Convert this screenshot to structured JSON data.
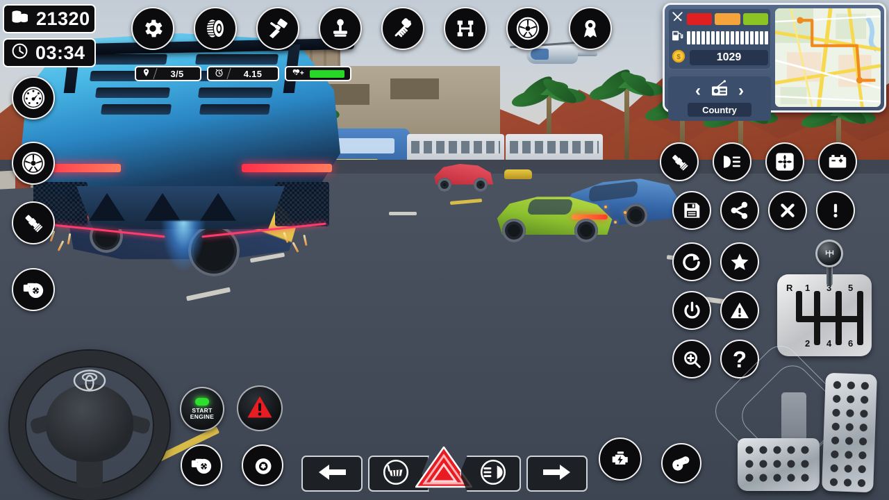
{
  "hud": {
    "coins_label": "coins",
    "coins_value": "21320",
    "timer_value": "03:34",
    "checkpoint_value": "3/5",
    "lap_time_value": "4.15",
    "health_label": "health"
  },
  "top_toolbar": [
    {
      "name": "settings",
      "icon": "gear-icon"
    },
    {
      "name": "tires",
      "icon": "tire-icon"
    },
    {
      "name": "engine",
      "icon": "piston-icon"
    },
    {
      "name": "gearbox",
      "icon": "joystick-icon"
    },
    {
      "name": "suspension",
      "icon": "shock-absorber-icon"
    },
    {
      "name": "chassis",
      "icon": "chassis-icon"
    },
    {
      "name": "rims",
      "icon": "wheel-rim-icon"
    },
    {
      "name": "rewards",
      "icon": "award-ribbon-icon"
    }
  ],
  "left_toolbar": [
    {
      "name": "speedometer",
      "icon": "speedometer-icon"
    },
    {
      "name": "wheel",
      "icon": "wheel-rim-icon"
    },
    {
      "name": "spark-plug",
      "icon": "spark-plug-icon"
    },
    {
      "name": "turbo",
      "icon": "turbo-icon"
    }
  ],
  "right_toolbar": [
    {
      "name": "spark-plug",
      "icon": "spark-plug-icon"
    },
    {
      "name": "headlights",
      "icon": "headlight-icon"
    },
    {
      "name": "cooling-fan",
      "icon": "fan-icon"
    },
    {
      "name": "battery",
      "icon": "battery-icon"
    },
    {
      "name": "save",
      "icon": "floppy-disk-icon"
    },
    {
      "name": "share",
      "icon": "share-icon"
    },
    {
      "name": "close",
      "icon": "close-x-icon"
    },
    {
      "name": "alert",
      "icon": "exclamation-icon"
    },
    {
      "name": "restart",
      "icon": "restart-icon"
    },
    {
      "name": "favorite",
      "icon": "star-icon"
    },
    {
      "name": "power",
      "icon": "power-icon"
    },
    {
      "name": "warning",
      "icon": "warning-triangle-icon"
    },
    {
      "name": "zoom-in",
      "icon": "magnifier-plus-icon"
    },
    {
      "name": "help",
      "icon": "question-mark-icon"
    }
  ],
  "dashboard": {
    "condition_label": "tools",
    "condition_segments": [
      "#e02020",
      "#f5a43c",
      "#8cc424"
    ],
    "fuel_label": "fuel-pump",
    "fuel_bars": 17,
    "money_value": "1029",
    "radio_station": "Country",
    "radio_prev": "‹",
    "radio_next": "›"
  },
  "shifter": {
    "top_labels": [
      "R",
      "1",
      "3",
      "5"
    ],
    "bottom_labels": [
      "2",
      "4",
      "6"
    ]
  },
  "bottom_bar": [
    {
      "name": "turn-left",
      "icon": "arrow-left-icon"
    },
    {
      "name": "wipers",
      "icon": "wiper-icon"
    },
    {
      "name": "hazard",
      "icon": "hazard-triangle-icon"
    },
    {
      "name": "headlight",
      "icon": "headlight-beam-icon"
    },
    {
      "name": "turn-right",
      "icon": "arrow-right-icon"
    }
  ],
  "controls": {
    "start_engine_line1": "START",
    "start_engine_line2": "ENGINE",
    "warning_icon": "warning-triangle-icon",
    "turbo_icon": "turbo-icon",
    "brake_icon": "brake-disc-icon",
    "engine_boost_icon": "engine-bolt-icon",
    "belt_icon": "belt-pulley-icon",
    "steering_icon": "steering-wheel",
    "brake_pedal": "brake-pedal",
    "gas_pedal": "accelerator-pedal"
  },
  "colors": {
    "hud_bg": "#0b0b0d",
    "hud_border": "#ffffff",
    "health_green": "#27d827",
    "hazard_red": "#e81c23",
    "dash_panel": "#41536f",
    "led_green": "#2ee02e"
  }
}
